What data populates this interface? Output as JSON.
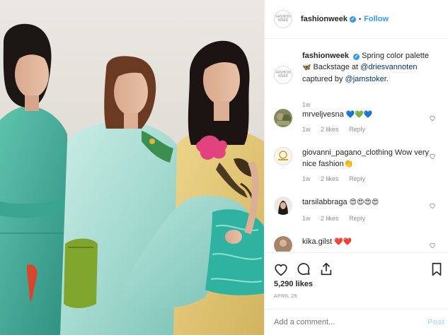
{
  "header": {
    "avatar_text": "FASHION WEEK",
    "username": "fashionweek",
    "verified": "✓",
    "separator": "•",
    "follow_label": "Follow"
  },
  "caption": {
    "avatar_text": "FASHION WEEK",
    "username": "fashionweek",
    "verified": "✓",
    "text_1": "Spring color palette",
    "emoji_1": "🦋",
    "text_2": "Backstage at",
    "mention_1": "@driesvannoten",
    "text_3": "captured by",
    "mention_2": "@jamstoker",
    "text_4": ".",
    "time": "1w"
  },
  "comments": [
    {
      "username": "mrveljvesna",
      "text": "💙💚💙",
      "time": "1w",
      "likes": "2 likes",
      "reply": "Reply"
    },
    {
      "username": "giovanni_pagano_clothing",
      "text": "Wow very nice fashion👏",
      "time": "1w",
      "likes": "2 likes",
      "reply": "Reply"
    },
    {
      "username": "tarsilabbraga",
      "text": "😍😍😍😍",
      "time": "1w",
      "likes": "2 likes",
      "reply": "Reply"
    },
    {
      "username": "kika.gilst",
      "text": "❤️❤️",
      "time": "",
      "likes": "",
      "reply": ""
    }
  ],
  "actions": {
    "like_icon": "heart-icon",
    "comment_icon": "comment-icon",
    "share_icon": "share-icon",
    "save_icon": "bookmark-icon",
    "likes": "5,290 likes",
    "date": "APRIL 26",
    "add_placeholder": "Add a comment...",
    "post_label": "Post"
  },
  "colors": {
    "accent": "#3897f0",
    "post_disabled": "#b2dffc",
    "muted": "#8e8e8e",
    "text": "#262626"
  }
}
